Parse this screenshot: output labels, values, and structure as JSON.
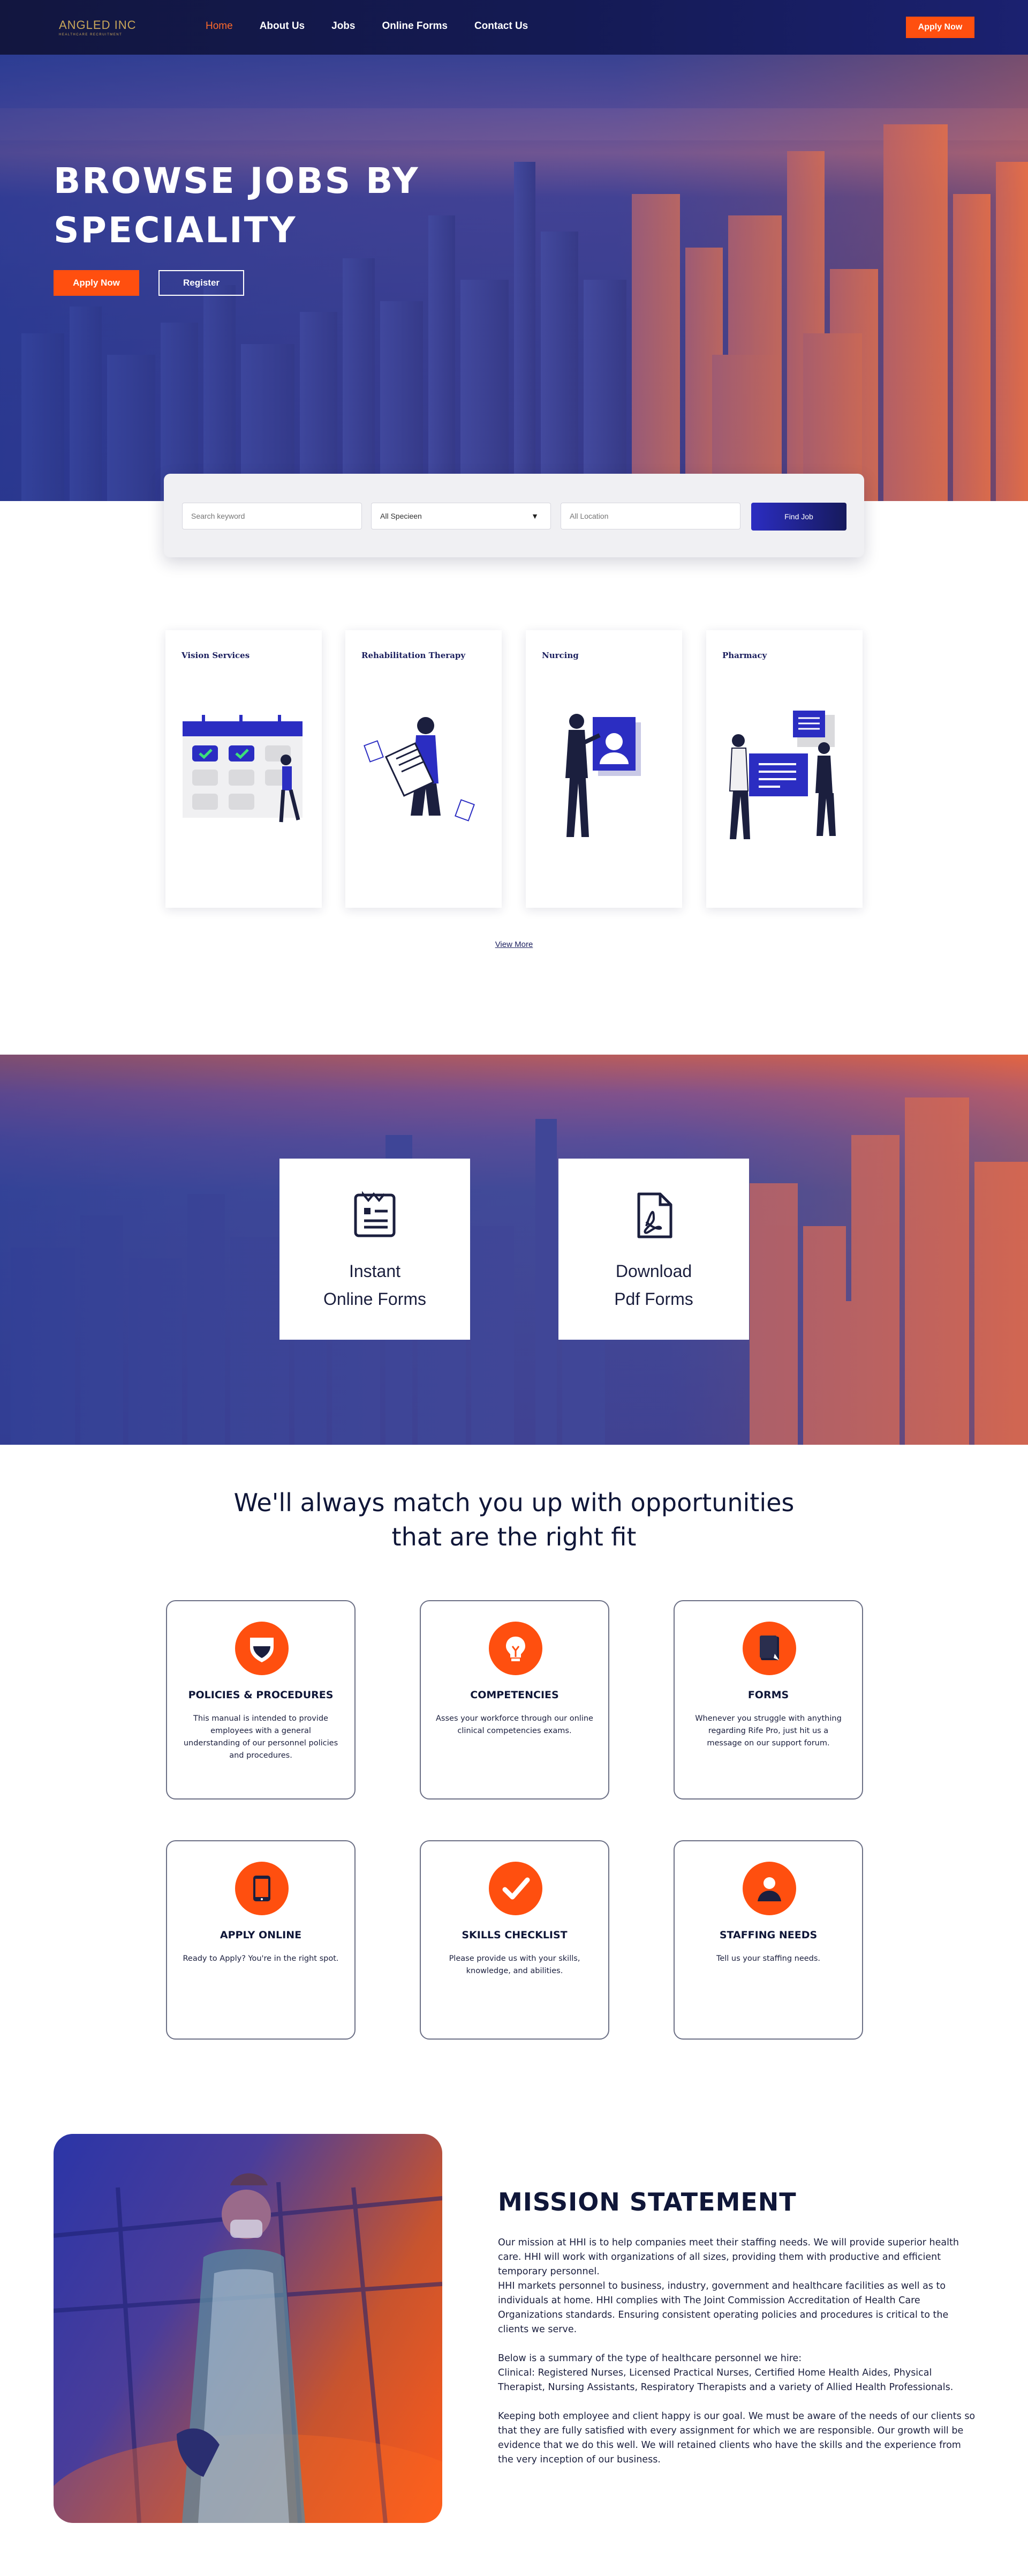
{
  "nav": {
    "logo_main": "ANGLED INC",
    "logo_sub": "HEALTHCARE RECRUITMENT",
    "links": [
      "Home",
      "About Us",
      "Jobs",
      "Online Forms",
      "Contact Us"
    ],
    "apply_label": "Apply Now",
    "accent_color": "#ff4f0f"
  },
  "hero": {
    "title_line1": "BROWSE JOBS BY",
    "title_line2": "SPECIALITY",
    "apply_label": "Apply Now",
    "register_label": "Register"
  },
  "search": {
    "keyword_placeholder": "Search keyword",
    "specialty_value": "All Specieen",
    "location_placeholder": "All Location",
    "find_label": "Find Job"
  },
  "specialties": [
    {
      "label": "Vision Services",
      "icon": "calendar-illustration"
    },
    {
      "label": "Rehabilitation Therapy",
      "icon": "document-illustration"
    },
    {
      "label": "Nurcing",
      "icon": "profile-card-illustration"
    },
    {
      "label": "Pharmacy",
      "icon": "presentation-illustration"
    }
  ],
  "view_more": "View More",
  "forms_banner": {
    "cards": [
      {
        "line1": "Instant",
        "line2": "Online Forms",
        "icon": "form-icon"
      },
      {
        "line1": "Download",
        "line2": "Pdf Forms",
        "icon": "pdf-icon"
      }
    ]
  },
  "opportunities": {
    "heading_line1": "We'll always match you up with opportunities",
    "heading_line2": "that are the right fit",
    "features": [
      {
        "title": "POLICIES & PROCEDURES",
        "desc": "This manual is intended to provide employees with a general understanding of our personnel policies and procedures.",
        "icon": "shield-icon"
      },
      {
        "title": "COMPETENCIES",
        "desc": "Asses your workforce through our online clinical competencies exams.",
        "icon": "lightbulb-icon"
      },
      {
        "title": "FORMS",
        "desc": "Whenever you struggle with anything regarding Rife Pro, just hit us a message on our support forum.",
        "icon": "document-icon"
      },
      {
        "title": "APPLY ONLINE",
        "desc": "Ready to Apply? You're in the right spot.",
        "icon": "tablet-icon"
      },
      {
        "title": "SKILLS CHECKLIST",
        "desc": "Please provide us with your skills, knowledge, and abilities.",
        "icon": "checkmark-icon"
      },
      {
        "title": "STAFFING NEEDS",
        "desc": "Tell us your staffing needs.",
        "icon": "user-icon"
      }
    ]
  },
  "mission": {
    "title": "MISSION STATEMENT",
    "p1": "Our mission at HHI is to help companies meet their staffing needs. We will provide superior health care. HHI will work with organizations of all sizes, providing them with productive and efficient temporary personnel.",
    "p2": "HHI markets personnel to business, industry, government and healthcare facilities as well as to individuals at home. HHI complies with The Joint Commission Accreditation of Health Care Organizations standards. Ensuring consistent operating policies and procedures is critical to the clients we serve.",
    "p3": "Below is a summary of the type of healthcare personnel we hire:",
    "p4": "Clinical: Registered Nurses, Licensed Practical Nurses, Certified Home Health Aides, Physical Therapist, Nursing Assistants, Respiratory Therapists and a variety of Allied Health Professionals.",
    "p5": "Keeping both employee and client happy is our goal. We must be aware of the needs of our clients so that they are fully satisfied with every assignment for which we are responsible. Our growth will be evidence that we do this well. We will retained clients who have the skills and the experience from the very inception of our business."
  }
}
